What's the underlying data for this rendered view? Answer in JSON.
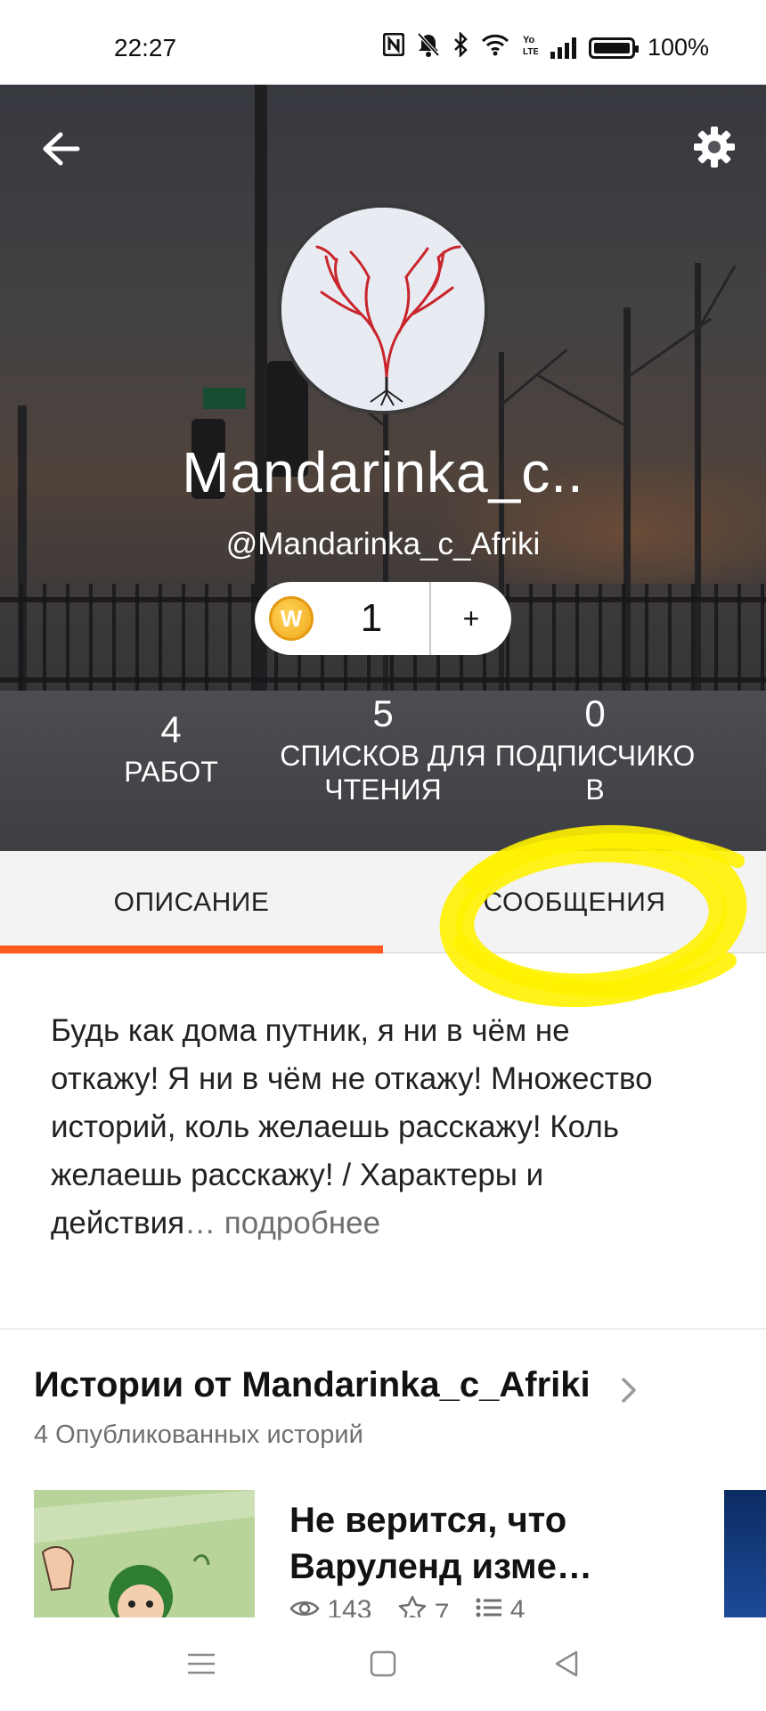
{
  "status_bar": {
    "time": "22:27",
    "battery_text": "100%",
    "icons": [
      "nfc-icon",
      "mute-bell-icon",
      "bluetooth-icon",
      "wifi-icon",
      "volte-icon",
      "signal-icon",
      "battery-icon"
    ]
  },
  "profile": {
    "display_name": "Mandarinka_c..",
    "username": "@Mandarinka_c_Afriki",
    "coins": {
      "count": "1",
      "add_label": "+",
      "icon": "coin-icon"
    },
    "stats": [
      {
        "value": "4",
        "label_line1": "РАБОТ",
        "label_line2": ""
      },
      {
        "value": "5",
        "label_line1": "СПИСКОВ ДЛЯ",
        "label_line2": "ЧТЕНИЯ"
      },
      {
        "value": "0",
        "label_line1": "ПОДПИСЧИКО",
        "label_line2": "В"
      }
    ]
  },
  "tabs": [
    {
      "label": "ОПИСАНИЕ",
      "active": true
    },
    {
      "label": "СООБЩЕНИЯ",
      "active": false
    }
  ],
  "description": {
    "text": "Будь как дома путник, я ни в чём не откажу! Я ни в чём не откажу! Множество историй, коль желаешь расскажу! Коль желаешь расскажу! / Характеры и действия",
    "ellipsis": "…",
    "more_label": " подробнее"
  },
  "stories": {
    "title": "Истории от Mandarinka_c_Afriki",
    "count_label": "4 Опубликованных историй",
    "items": [
      {
        "title": "Не верится, что Варуленд изме…",
        "views": "143",
        "votes": "7",
        "parts": "4"
      }
    ]
  },
  "colors": {
    "accent": "#ff5a1f",
    "highlight": "#fff200",
    "muted_text": "#6f6f6f"
  }
}
